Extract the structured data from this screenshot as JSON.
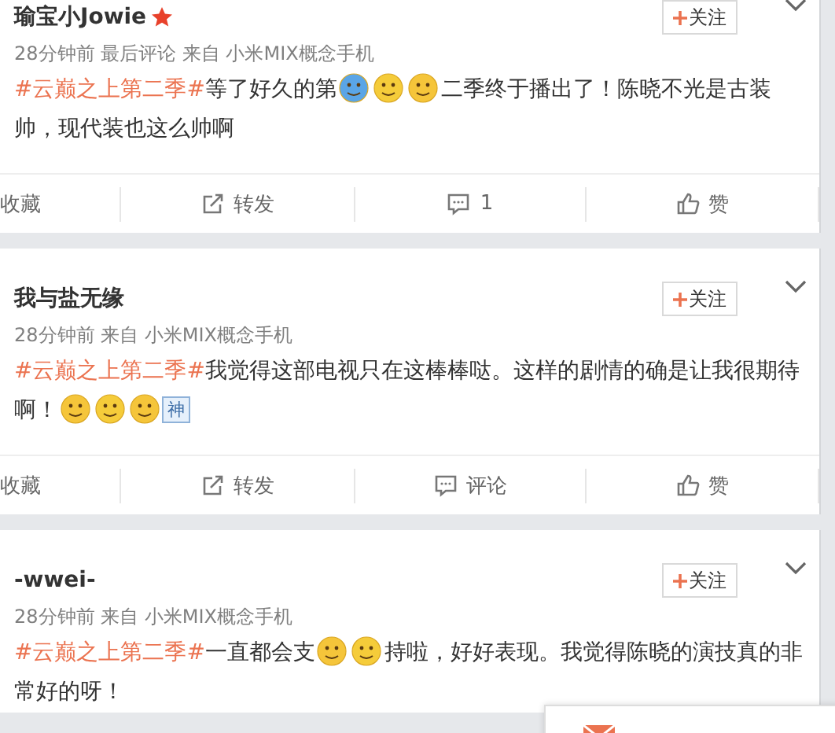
{
  "posts": [
    {
      "author": "瑜宝小Jowie",
      "starred": true,
      "follow": "关注",
      "meta": "28分钟前 最后评论 来自 小米MIX概念手机",
      "content": [
        {
          "kind": "hashtag",
          "text": "#云巅之上第二季#"
        },
        {
          "kind": "text",
          "text": "等了好久的第"
        },
        {
          "kind": "emoji"
        },
        {
          "kind": "emoji"
        },
        {
          "kind": "emoji"
        },
        {
          "kind": "text",
          "text": "二季终于播出了！陈晓不光是古装帅，现代装也这么帅啊"
        }
      ],
      "actions": [
        {
          "kind": "favorite",
          "label": "收藏"
        },
        {
          "kind": "repost",
          "label": "转发"
        },
        {
          "kind": "comment",
          "label": "1"
        },
        {
          "kind": "like",
          "label": "赞"
        }
      ]
    },
    {
      "author": "我与盐无缘",
      "starred": false,
      "follow": "关注",
      "meta": "28分钟前 来自 小米MIX概念手机",
      "content": [
        {
          "kind": "hashtag",
          "text": "#云巅之上第二季#"
        },
        {
          "kind": "text",
          "text": "我觉得这部电视只在这棒棒哒。这样的剧情的确是让我很期待啊！"
        },
        {
          "kind": "emoji"
        },
        {
          "kind": "emoji"
        },
        {
          "kind": "emoji"
        },
        {
          "kind": "tile",
          "text": "神"
        }
      ],
      "actions": [
        {
          "kind": "favorite",
          "label": "收藏"
        },
        {
          "kind": "repost",
          "label": "转发"
        },
        {
          "kind": "comment",
          "label": "评论"
        },
        {
          "kind": "like",
          "label": "赞"
        }
      ]
    },
    {
      "author": "-wwei-",
      "starred": false,
      "follow": "关注",
      "meta": "28分钟前 来自 小米MIX概念手机",
      "content": [
        {
          "kind": "hashtag",
          "text": "#云巅之上第二季#"
        },
        {
          "kind": "text",
          "text": "一直都会支"
        },
        {
          "kind": "emoji"
        },
        {
          "kind": "emoji"
        },
        {
          "kind": "text",
          "text": "持啦，好好表现。我觉得陈晓的演技真的非常好的呀！"
        }
      ]
    }
  ]
}
